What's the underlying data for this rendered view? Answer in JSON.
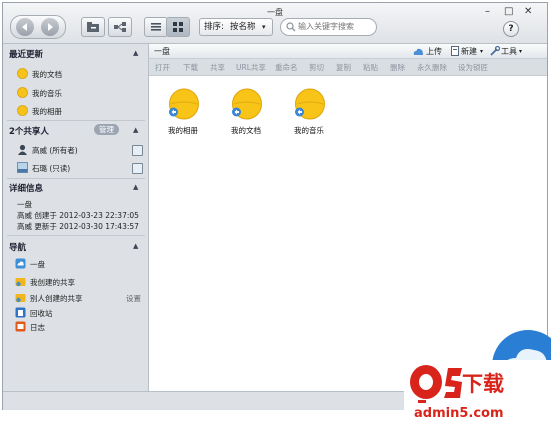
{
  "window": {
    "title": "一盘",
    "controls": {
      "minimize": "–",
      "maximize": "□",
      "close": "✕"
    }
  },
  "toolbar": {
    "sort_label": "排序:",
    "sort_value": "按名称",
    "search_placeholder": "输入关键字搜索",
    "help": "?"
  },
  "sidebar": {
    "recent": {
      "title": "最近更新",
      "items": [
        {
          "label": "我的文档",
          "icon": "folder-icon"
        },
        {
          "label": "我的音乐",
          "icon": "folder-icon"
        },
        {
          "label": "我的相册",
          "icon": "folder-icon"
        }
      ]
    },
    "sharers": {
      "title": "2个共享人",
      "manage": "管理",
      "items": [
        {
          "label": "高威 (所有者)",
          "icon": "user-icon"
        },
        {
          "label": "石璐 (只读)",
          "icon": "user-icon"
        }
      ]
    },
    "details": {
      "title": "详细信息",
      "name": "一盘",
      "created": "高威 创建于 2012-03-23 22:37:05",
      "updated": "高威 更新于 2012-03-30 17:43:57"
    },
    "navigation": {
      "title": "导航",
      "items": [
        {
          "label": "一盘",
          "icon": "cloud-icon"
        },
        {
          "label": "我创建的共享",
          "icon": "shared-folder-icon"
        },
        {
          "label": "别人创建的共享",
          "icon": "shared-folder-icon",
          "extra": "设置"
        },
        {
          "label": "回收站",
          "icon": "trash-icon"
        },
        {
          "label": "日志",
          "icon": "log-icon"
        }
      ]
    }
  },
  "main": {
    "breadcrumb": "一盘",
    "upload": "上传",
    "new": "新建",
    "tools": "工具",
    "actions": [
      "打开",
      "下载",
      "共享",
      "URL共享",
      "重命名",
      "剪切",
      "复制",
      "粘贴",
      "删除",
      "永久删除",
      "设为锁匠"
    ],
    "files": [
      {
        "name": "我的相册"
      },
      {
        "name": "我的文档"
      },
      {
        "name": "我的音乐"
      }
    ]
  },
  "watermark": {
    "brand": "下载",
    "url": "admin5.com",
    "colors": {
      "red": "#d9241b",
      "blue": "#2a7fd4"
    }
  }
}
